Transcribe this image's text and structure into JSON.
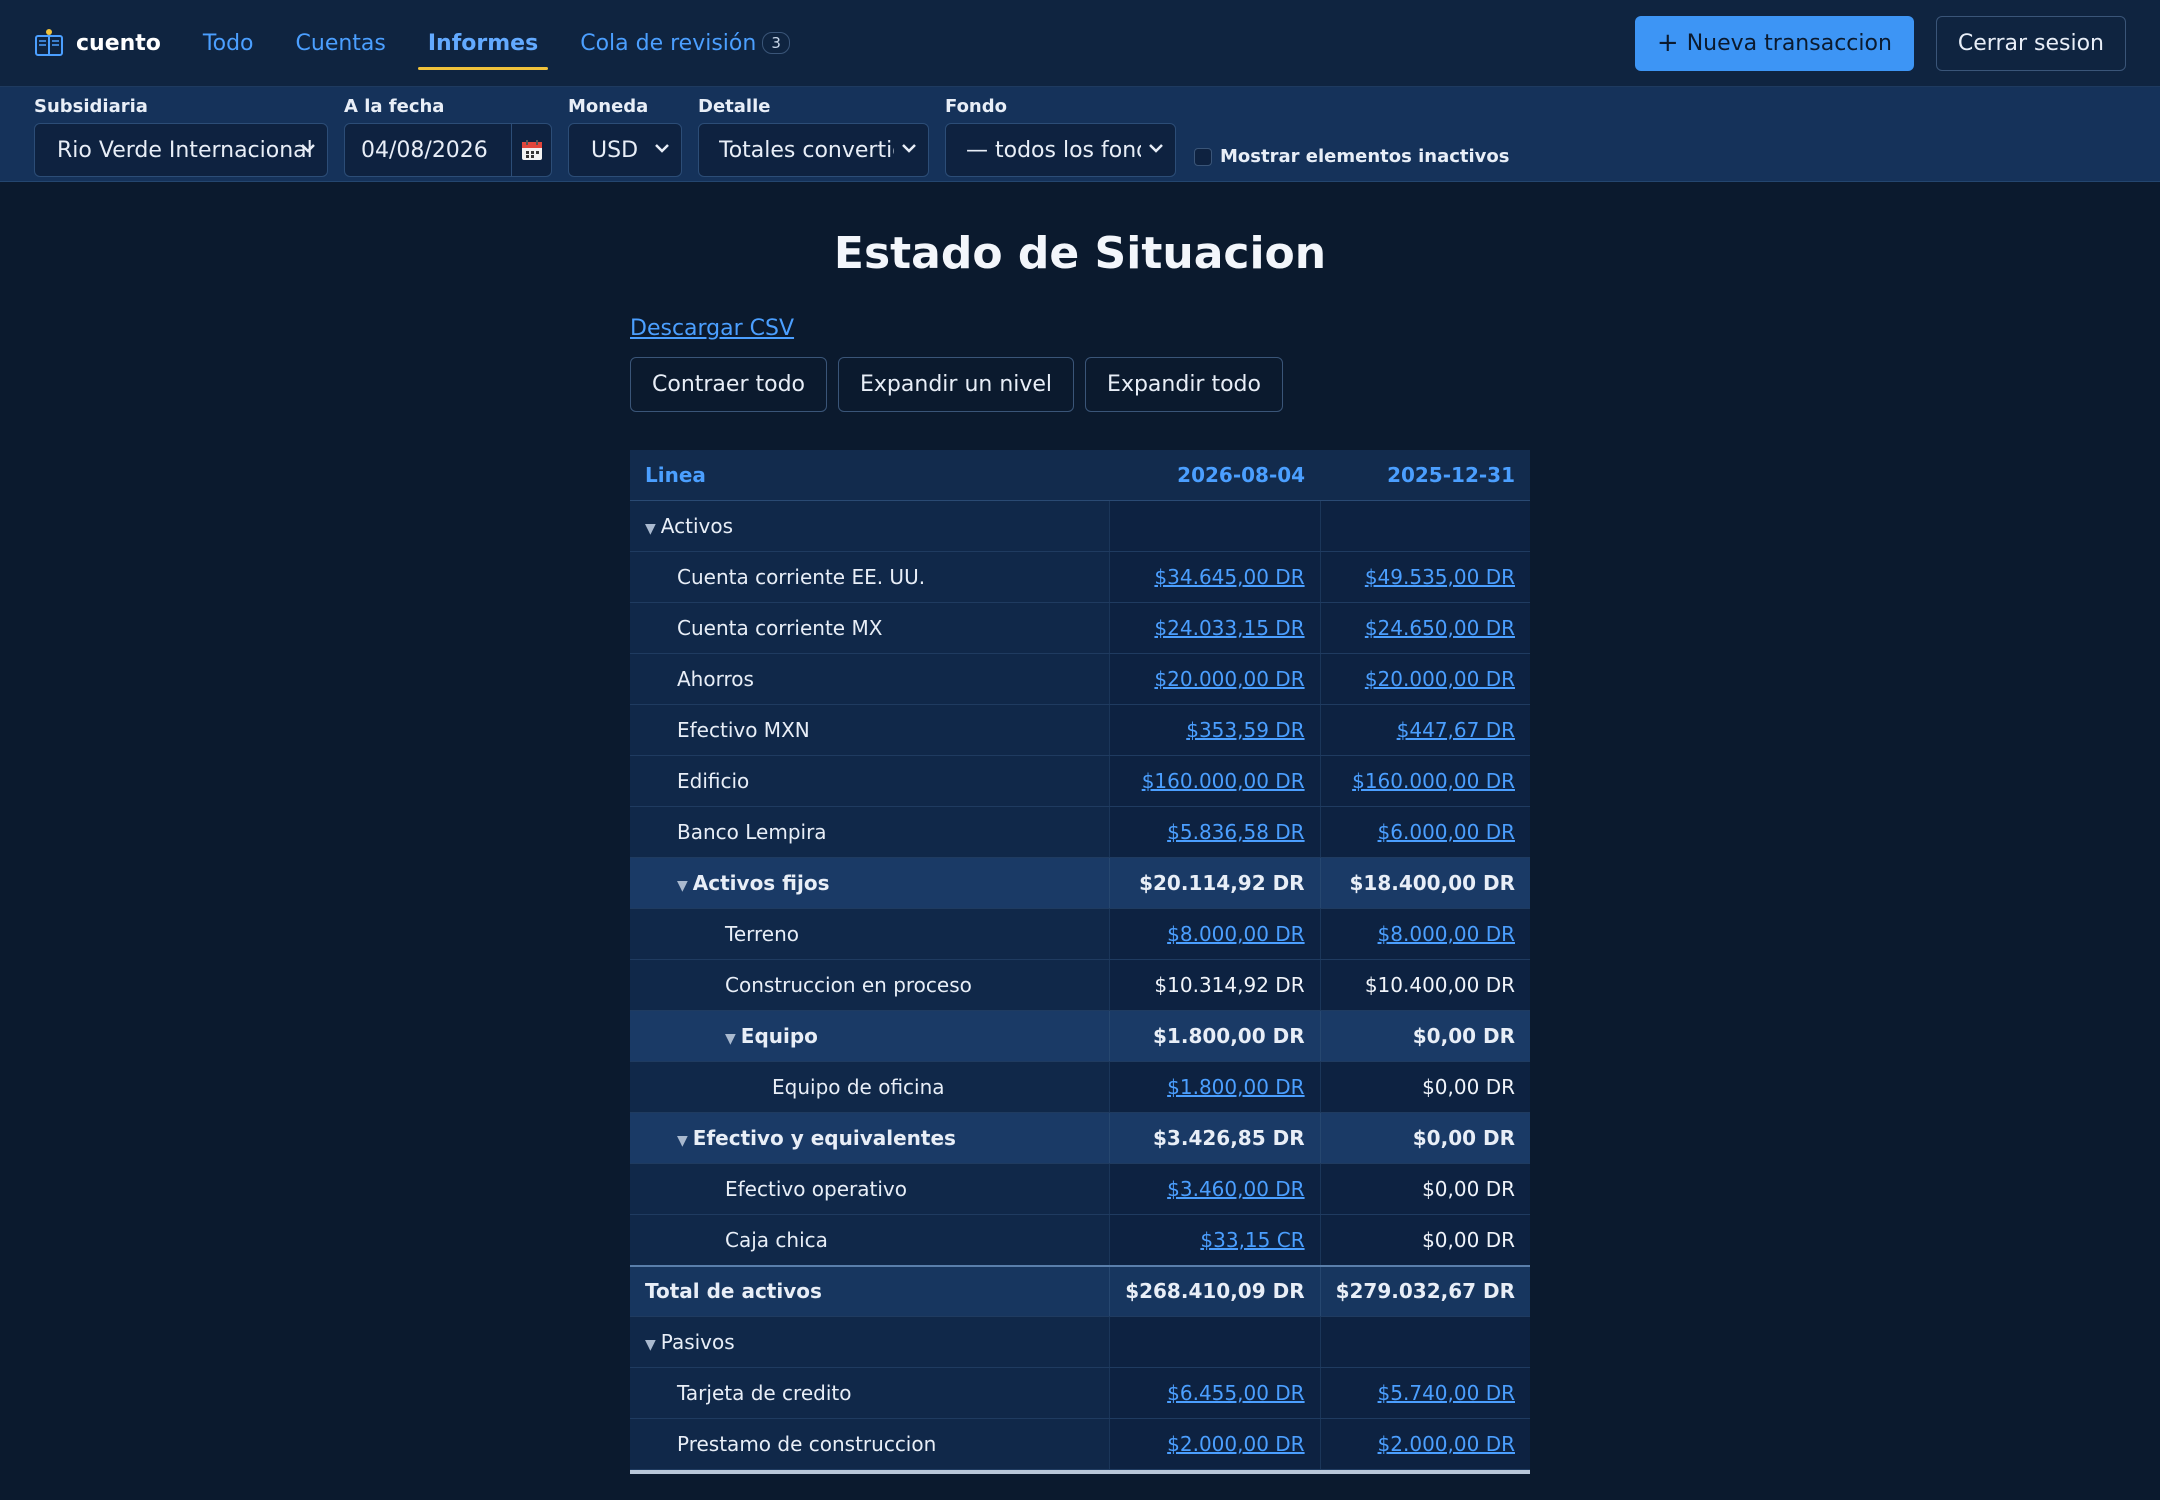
{
  "nav": {
    "brand": "cuento",
    "items": [
      {
        "label": "Todo"
      },
      {
        "label": "Cuentas"
      },
      {
        "label": "Informes"
      },
      {
        "label": "Cola de revisión",
        "badge": "3"
      }
    ],
    "new_transaction": "Nueva transaccion",
    "logout": "Cerrar sesion"
  },
  "filters": {
    "subsidiary_label": "Subsidiaria",
    "subsidiary_value": "Rio Verde Internacional",
    "date_label": "A la fecha",
    "date_value": "04/08/2026",
    "currency_label": "Moneda",
    "currency_value": "USD",
    "detail_label": "Detalle",
    "detail_value": "Totales convertid",
    "fund_label": "Fondo",
    "fund_value": "— todos los fond",
    "inactive_label": "Mostrar elementos inactivos"
  },
  "report": {
    "title": "Estado de Situacion",
    "csv": "Descargar CSV",
    "collapse_all": "Contraer todo",
    "expand_one": "Expandir un nivel",
    "expand_all": "Expandir todo",
    "columns": [
      "Linea",
      "2026-08-04",
      "2025-12-31"
    ],
    "rows": [
      {
        "label": "Activos",
        "v1": "",
        "v2": ""
      },
      {
        "label": "Cuenta corriente EE. UU.",
        "v1": "$34.645,00 DR",
        "v2": "$49.535,00 DR"
      },
      {
        "label": "Cuenta corriente MX",
        "v1": "$24.033,15 DR",
        "v2": "$24.650,00 DR"
      },
      {
        "label": "Ahorros",
        "v1": "$20.000,00 DR",
        "v2": "$20.000,00 DR"
      },
      {
        "label": "Efectivo MXN",
        "v1": "$353,59 DR",
        "v2": "$447,67 DR"
      },
      {
        "label": "Edificio",
        "v1": "$160.000,00 DR",
        "v2": "$160.000,00 DR"
      },
      {
        "label": "Banco Lempira",
        "v1": "$5.836,58 DR",
        "v2": "$6.000,00 DR"
      },
      {
        "label": "Activos fijos",
        "v1": "$20.114,92 DR",
        "v2": "$18.400,00 DR"
      },
      {
        "label": "Terreno",
        "v1": "$8.000,00 DR",
        "v2": "$8.000,00 DR"
      },
      {
        "label": "Construccion en proceso",
        "v1": "$10.314,92 DR",
        "v2": "$10.400,00 DR"
      },
      {
        "label": "Equipo",
        "v1": "$1.800,00 DR",
        "v2": "$0,00 DR"
      },
      {
        "label": "Equipo de oficina",
        "v1": "$1.800,00 DR",
        "v2": "$0,00 DR"
      },
      {
        "label": "Efectivo y equivalentes",
        "v1": "$3.426,85 DR",
        "v2": "$0,00 DR"
      },
      {
        "label": "Efectivo operativo",
        "v1": "$3.460,00 DR",
        "v2": "$0,00 DR"
      },
      {
        "label": "Caja chica",
        "v1": "$33,15 CR",
        "v2": "$0,00 DR"
      },
      {
        "label": "Total de activos",
        "v1": "$268.410,09 DR",
        "v2": "$279.032,67 DR"
      },
      {
        "label": "Pasivos",
        "v1": "",
        "v2": ""
      },
      {
        "label": "Tarjeta de credito",
        "v1": "$6.455,00 DR",
        "v2": "$5.740,00 DR"
      },
      {
        "label": "Prestamo de construccion",
        "v1": "$2.000,00 DR",
        "v2": "$2.000,00 DR"
      }
    ]
  },
  "colors": {
    "background": "#0b1a2e",
    "accent": "#4b9fff",
    "primary_button": "#3d95f5",
    "active_underline": "#f0c23b"
  }
}
